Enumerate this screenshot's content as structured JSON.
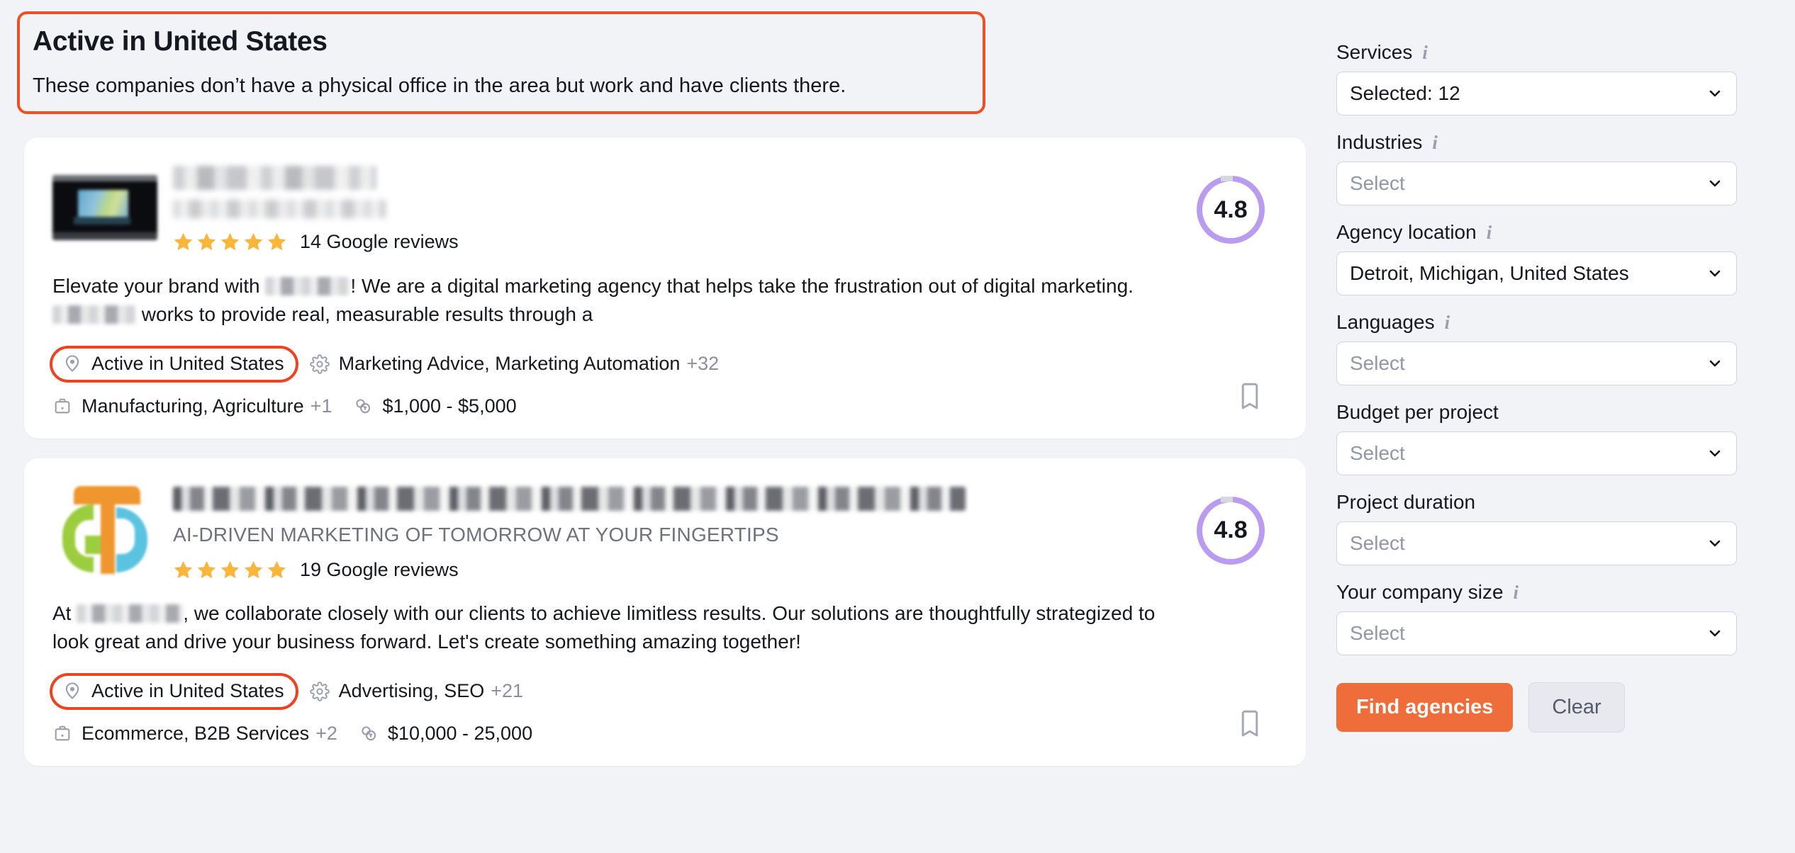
{
  "banner": {
    "title": "Active in United States",
    "subtitle": "These companies don’t have a physical office in the area but work and have clients there.",
    "border_color": "#ee5026"
  },
  "cards": [
    {
      "logo": "blurred-dark-screen-logo",
      "name_redacted": true,
      "tagline_redacted": true,
      "rating": "4.8",
      "rating_ring_color": "#b99bf0",
      "reviews": "14 Google reviews",
      "stars": 5,
      "description_part1": "Elevate your brand with ",
      "description_part2": "! We are a digital marketing agency that helps take the frustration out of digital marketing. ",
      "description_part3": " works to provide real, measurable results through a",
      "location_label": "Active in United States",
      "services": "Marketing Advice, Marketing Automation",
      "services_more": "+32",
      "industries": "Manufacturing, Agriculture",
      "industries_more": "+1",
      "budget": "$1,000 - $5,000",
      "bookmark_icon": "bookmark-icon",
      "location_icon": "map-pin-icon",
      "services_icon": "gear-icon",
      "industries_icon": "briefcase-icon",
      "budget_icon": "coins-icon"
    },
    {
      "logo": "colorful-g-logo",
      "name_redacted": true,
      "tagline": "AI-DRIVEN MARKETING OF TOMORROW AT YOUR FINGERTIPS",
      "rating": "4.8",
      "rating_ring_color": "#b99bf0",
      "reviews": "19 Google reviews",
      "stars": 5,
      "description_part1": "At ",
      "description_part2": ", we collaborate closely with our clients to achieve limitless results. Our solutions are thoughtfully strategized to look great and drive your business forward. Let's create something amazing together!",
      "location_label": "Active in United States",
      "services": "Advertising, SEO",
      "services_more": "+21",
      "industries": "Ecommerce, B2B Services",
      "industries_more": "+2",
      "budget": "$10,000 - 25,000",
      "bookmark_icon": "bookmark-icon",
      "location_icon": "map-pin-icon",
      "services_icon": "gear-icon",
      "industries_icon": "briefcase-icon",
      "budget_icon": "coins-icon"
    }
  ],
  "sidebar": {
    "filters": [
      {
        "label": "Services",
        "info": true,
        "value": "Selected: 12",
        "is_placeholder": false
      },
      {
        "label": "Industries",
        "info": true,
        "value": "Select",
        "is_placeholder": true
      },
      {
        "label": "Agency location",
        "info": true,
        "value": "Detroit, Michigan, United States",
        "is_placeholder": false
      },
      {
        "label": "Languages",
        "info": true,
        "value": "Select",
        "is_placeholder": true
      },
      {
        "label": "Budget per project",
        "info": false,
        "value": "Select",
        "is_placeholder": true
      },
      {
        "label": "Project duration",
        "info": false,
        "value": "Select",
        "is_placeholder": true
      },
      {
        "label": "Your company size",
        "info": true,
        "value": "Select",
        "is_placeholder": true
      }
    ],
    "find_button": "Find agencies",
    "clear_button": "Clear",
    "accent_color": "#ef6c3b"
  }
}
